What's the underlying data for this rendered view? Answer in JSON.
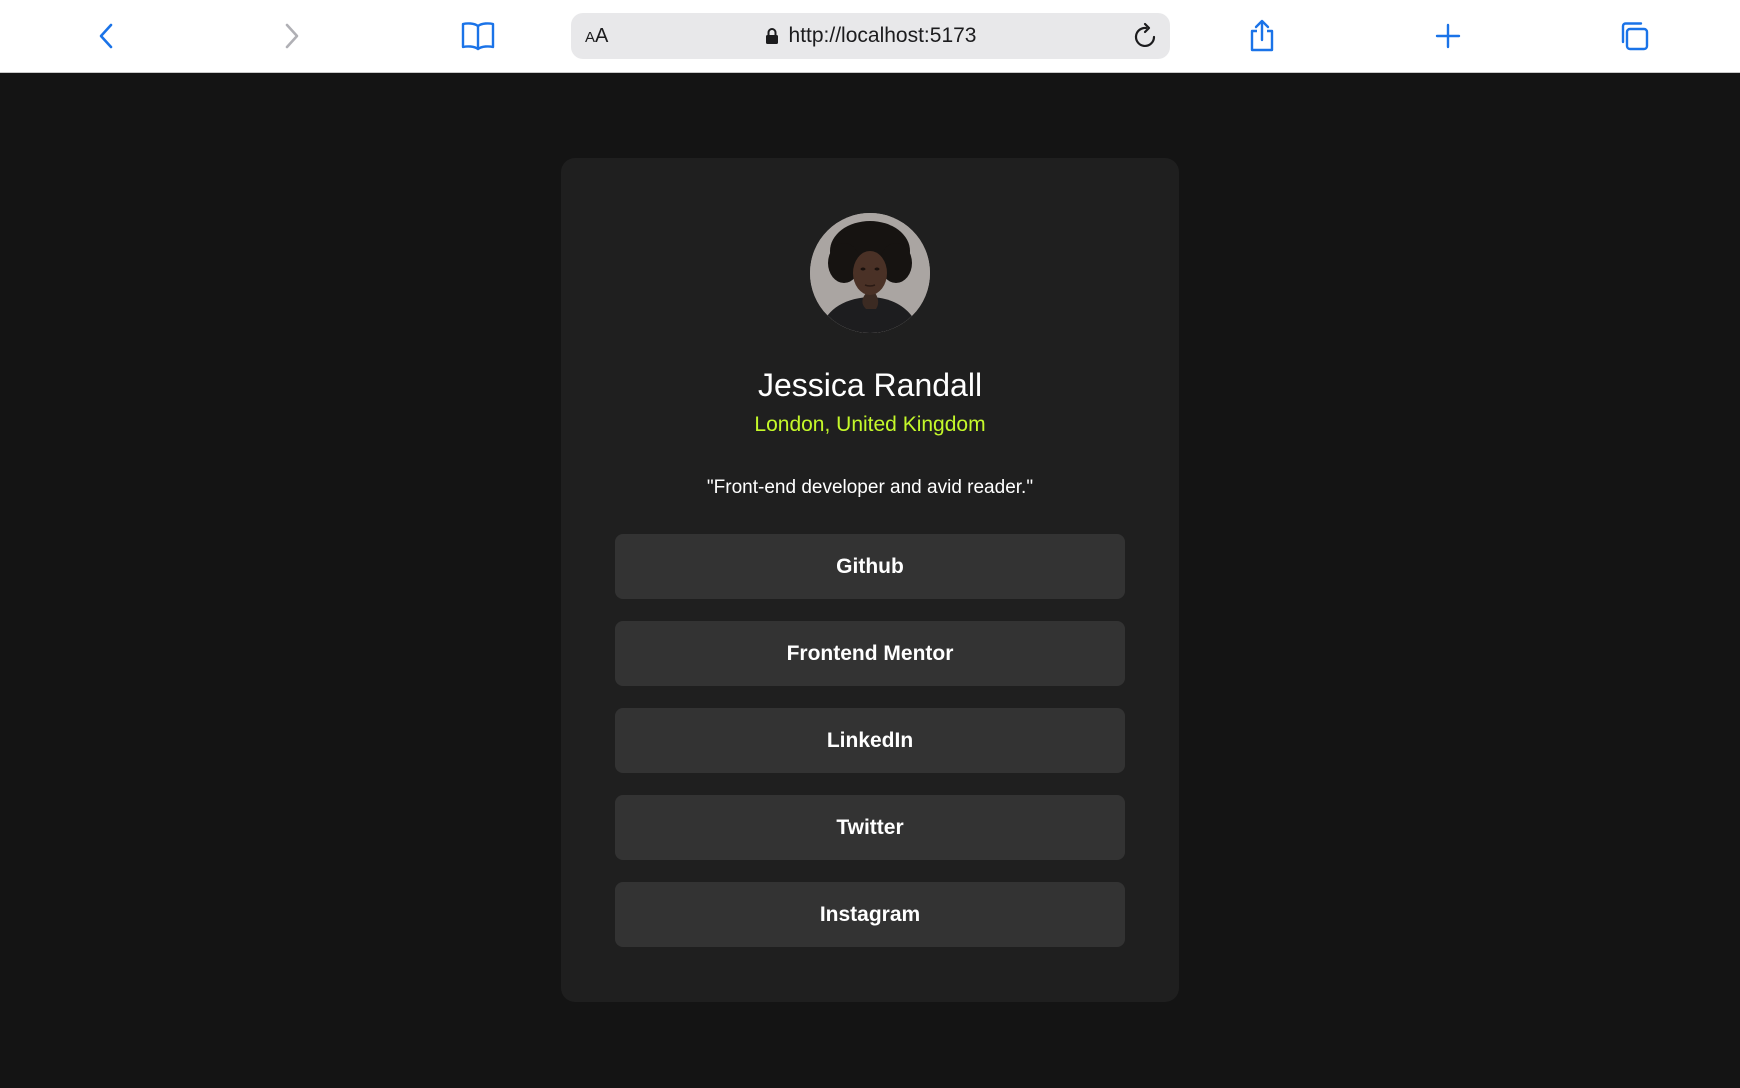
{
  "browser": {
    "icons": {
      "back": "chevron-left-icon",
      "forward": "chevron-right-icon",
      "bookmarks": "book-icon",
      "lock": "lock-icon",
      "reload": "reload-icon",
      "share": "share-icon",
      "new_tab": "plus-icon",
      "tabs": "tabs-icon"
    },
    "reader_label_small": "A",
    "reader_label_large": "A",
    "url": "http://localhost:5173",
    "accent_color": "#1a73e8"
  },
  "profile": {
    "avatar": "profile-photo",
    "name": "Jessica Randall",
    "location": "London, United Kingdom",
    "bio": "\"Front-end developer and avid reader.\"",
    "location_color": "#c4f82a"
  },
  "links": [
    {
      "label": "Github"
    },
    {
      "label": "Frontend Mentor"
    },
    {
      "label": "LinkedIn"
    },
    {
      "label": "Twitter"
    },
    {
      "label": "Instagram"
    }
  ]
}
